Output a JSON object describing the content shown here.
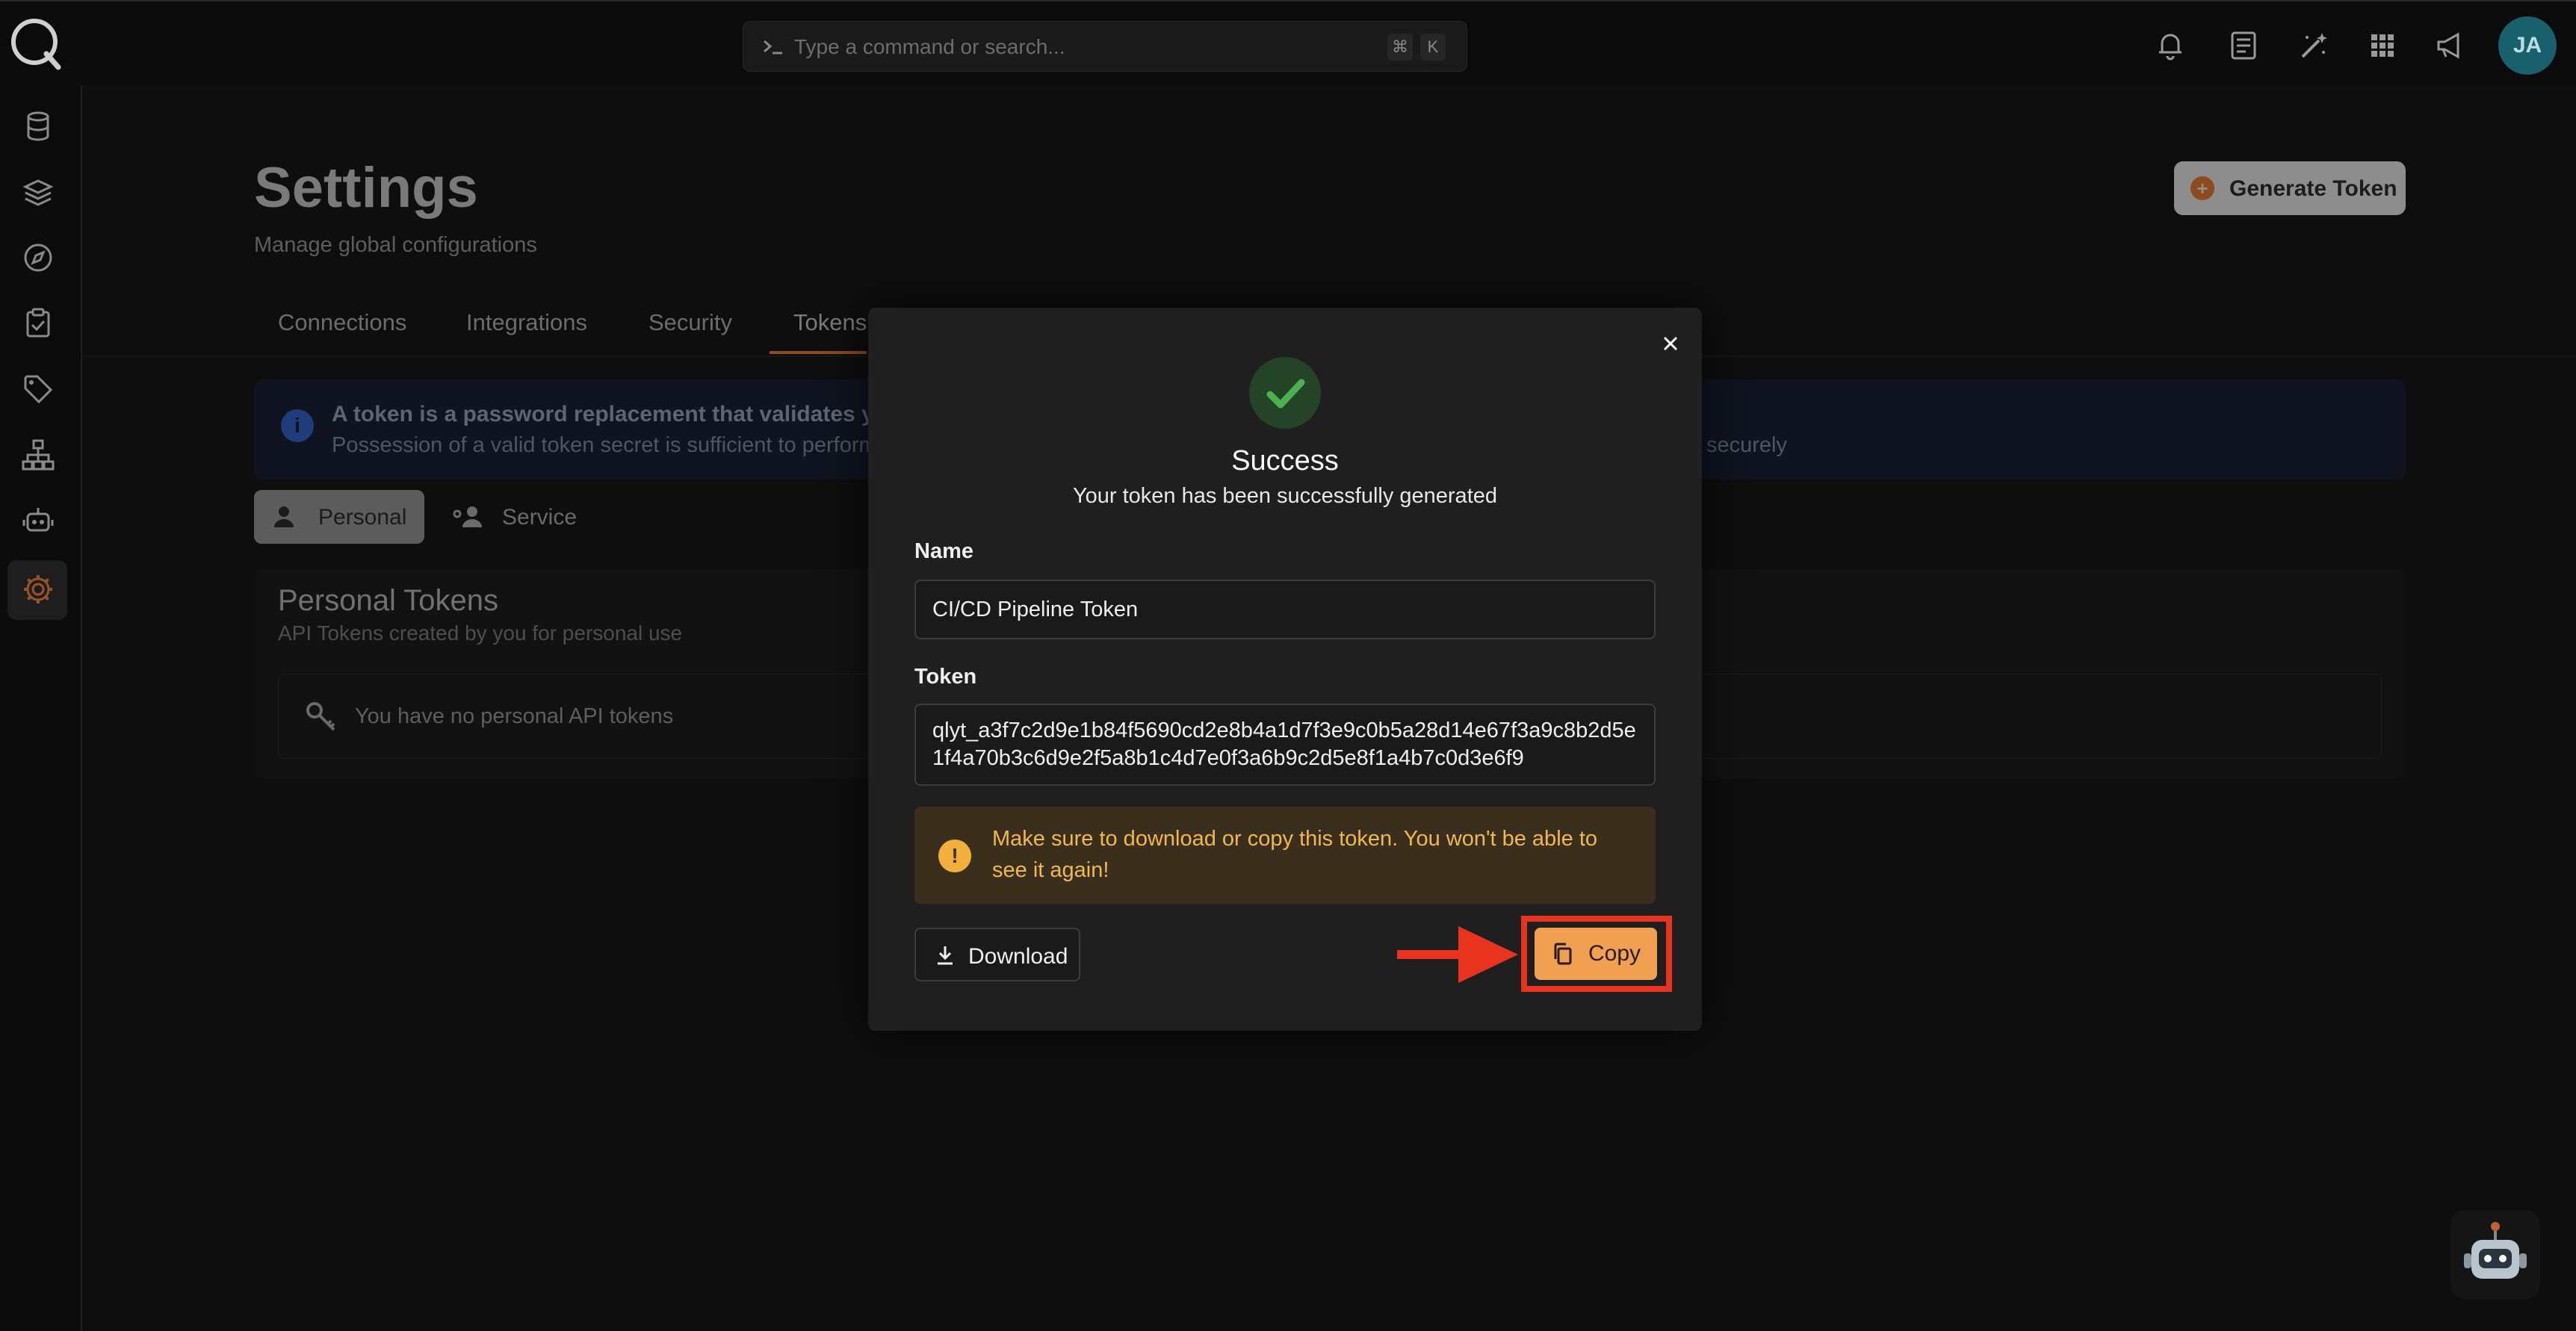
{
  "topbar": {
    "command_placeholder": "Type a command or search...",
    "shortcut_key1": "⌘",
    "shortcut_key2": "K",
    "avatar_initials": "JA"
  },
  "page": {
    "title": "Settings",
    "subtitle": "Manage global configurations",
    "generate_button": "Generate Token"
  },
  "tabs": [
    "Connections",
    "Integrations",
    "Security",
    "Tokens"
  ],
  "info_banner": {
    "line1": "A token is a password replacement that validates you",
    "line2": "Possession of a valid token secret is sufficient to perform",
    "line2_end": "securely"
  },
  "token_types": {
    "personal": "Personal",
    "service": "Service"
  },
  "personal_tokens": {
    "title": "Personal Tokens",
    "subtitle": "API Tokens created by you for personal use",
    "empty_text": "You have no personal API tokens"
  },
  "modal": {
    "title": "Success",
    "subtitle": "Your token has been successfully generated",
    "name_label": "Name",
    "name_value": "CI/CD Pipeline Token",
    "token_label": "Token",
    "token_value": "qlyt_a3f7c2d9e1b84f5690cd2e8b4a1d7f3e9c0b5a28d14e67f3a9c8b2d5e1f4a70b3c6d9e2f5a8b1c4d7e0f3a6b9c2d5e8f1a4b7c0d3e6f9",
    "warning": "Make sure to download or copy this token. You won't be able to see it again!",
    "download_button": "Download",
    "copy_button": "Copy"
  },
  "colors": {
    "accent": "#f0a050",
    "highlight": "#e8331f",
    "success": "#4caf50",
    "warning_text": "#f0b94a"
  }
}
